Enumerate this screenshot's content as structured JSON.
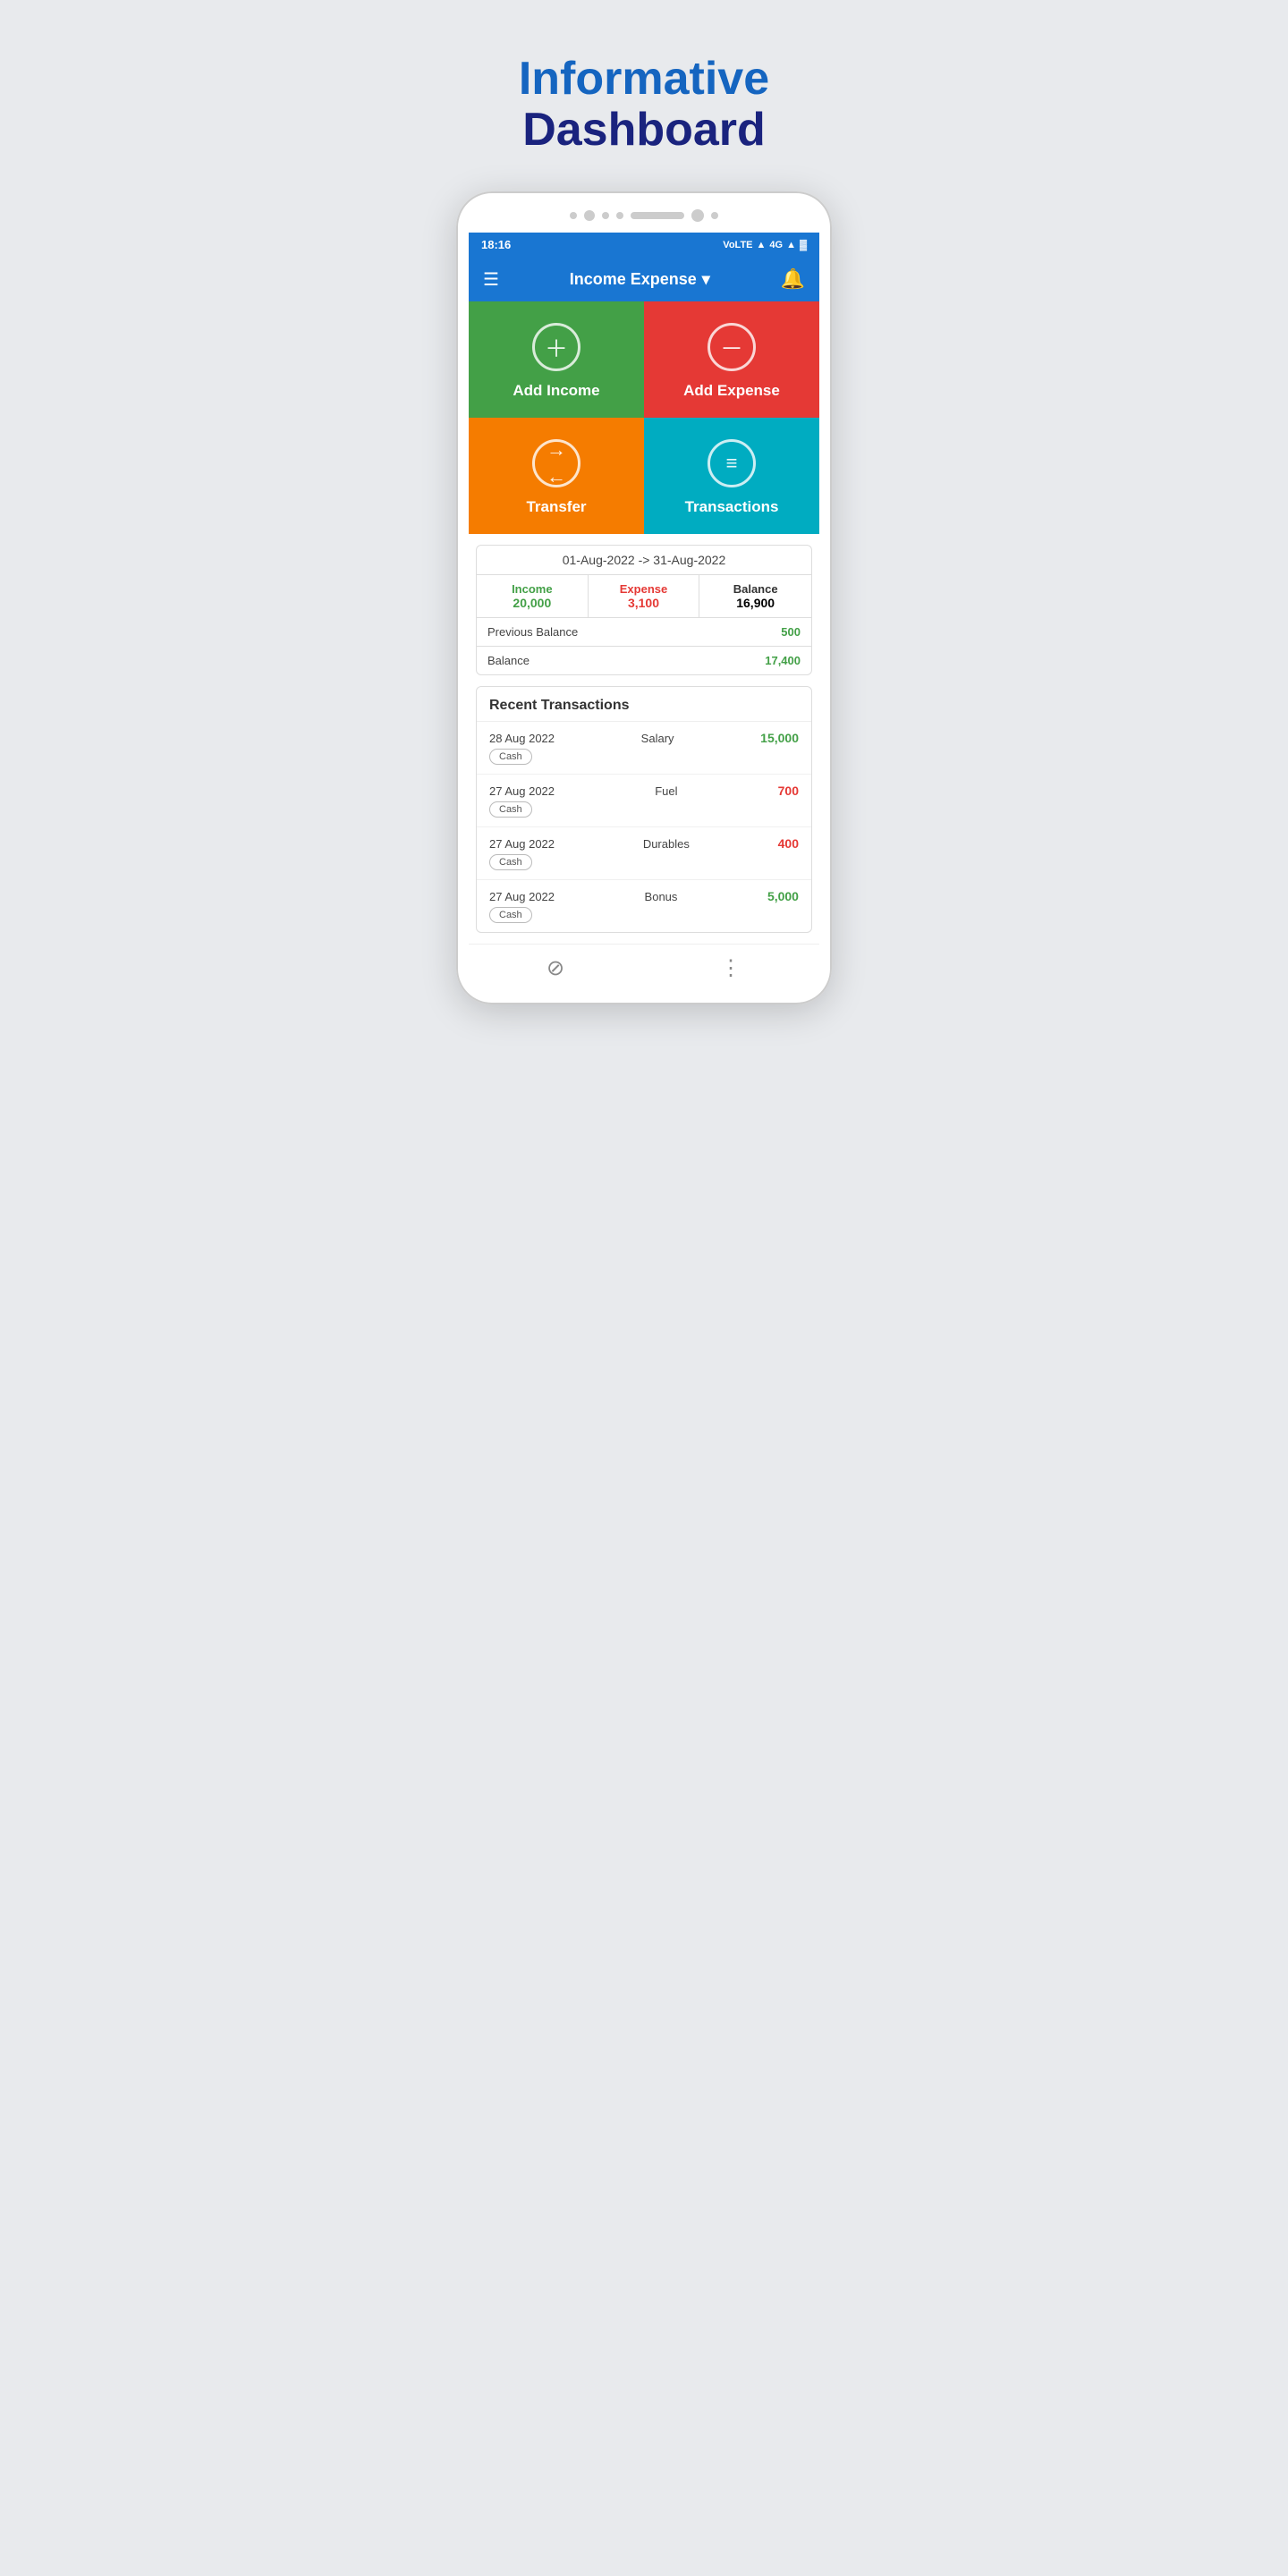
{
  "header": {
    "informative": "Informative",
    "dashboard": "Dashboard"
  },
  "status_bar": {
    "time": "18:16",
    "icons": "VoLTE 4G"
  },
  "app_bar": {
    "title": "Income Expense",
    "dropdown_icon": "▾"
  },
  "action_buttons": [
    {
      "id": "add-income",
      "label": "Add Income",
      "type": "plus",
      "color": "add-income"
    },
    {
      "id": "add-expense",
      "label": "Add Expense",
      "type": "minus",
      "color": "add-expense"
    },
    {
      "id": "transfer",
      "label": "Transfer",
      "type": "arrows",
      "color": "transfer"
    },
    {
      "id": "transactions",
      "label": "Transactions",
      "type": "list",
      "color": "transactions"
    }
  ],
  "summary": {
    "date_range": "01-Aug-2022 -> 31-Aug-2022",
    "income_label": "Income",
    "income_value": "20,000",
    "expense_label": "Expense",
    "expense_value": "3,100",
    "balance_label": "Balance",
    "balance_value": "16,900",
    "previous_balance_label": "Previous Balance",
    "previous_balance_value": "500",
    "total_balance_label": "Balance",
    "total_balance_value": "17,400"
  },
  "recent_transactions": {
    "title": "Recent Transactions",
    "items": [
      {
        "date": "28 Aug 2022",
        "name": "Salary",
        "amount": "15,000",
        "type": "positive",
        "tag": "Cash"
      },
      {
        "date": "27 Aug 2022",
        "name": "Fuel",
        "amount": "700",
        "type": "negative",
        "tag": "Cash"
      },
      {
        "date": "27 Aug 2022",
        "name": "Durables",
        "amount": "400",
        "type": "negative",
        "tag": "Cash"
      },
      {
        "date": "27 Aug 2022",
        "name": "Bonus",
        "amount": "5,000",
        "type": "positive",
        "tag": "Cash"
      }
    ]
  },
  "bottom_nav": {
    "left_icon": "⊘",
    "right_icon": "⋮"
  }
}
